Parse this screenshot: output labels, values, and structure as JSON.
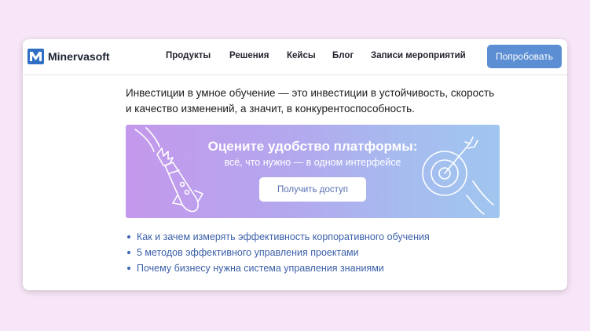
{
  "header": {
    "logo_text": "Minervasoft",
    "nav": [
      {
        "label": "Продукты"
      },
      {
        "label": "Решения"
      },
      {
        "label": "Кейсы"
      },
      {
        "label": "Блог"
      },
      {
        "label": "Записи мероприятий"
      }
    ],
    "cta_label": "Попробовать"
  },
  "main": {
    "intro_text": "Инвестиции в умное обучение — это инвестиции в устойчивость, скорость и качество изменений, а значит, в конкурентоспособность.",
    "banner": {
      "title": "Оцените удобство платформы:",
      "subtitle": "всё, что нужно — в одном интерфейсе",
      "button_label": "Получить доступ"
    },
    "links": [
      {
        "label": "Как и зачем измерять эффективность корпоративного обучения"
      },
      {
        "label": "5 методов эффективного управления проектами"
      },
      {
        "label": "Почему бизнесу нужна система управления знаниями"
      }
    ]
  },
  "colors": {
    "page_bg": "#f7e6f7",
    "accent": "#5b8ed2",
    "link": "#3a5fa8",
    "text": "#1c1c1c"
  }
}
